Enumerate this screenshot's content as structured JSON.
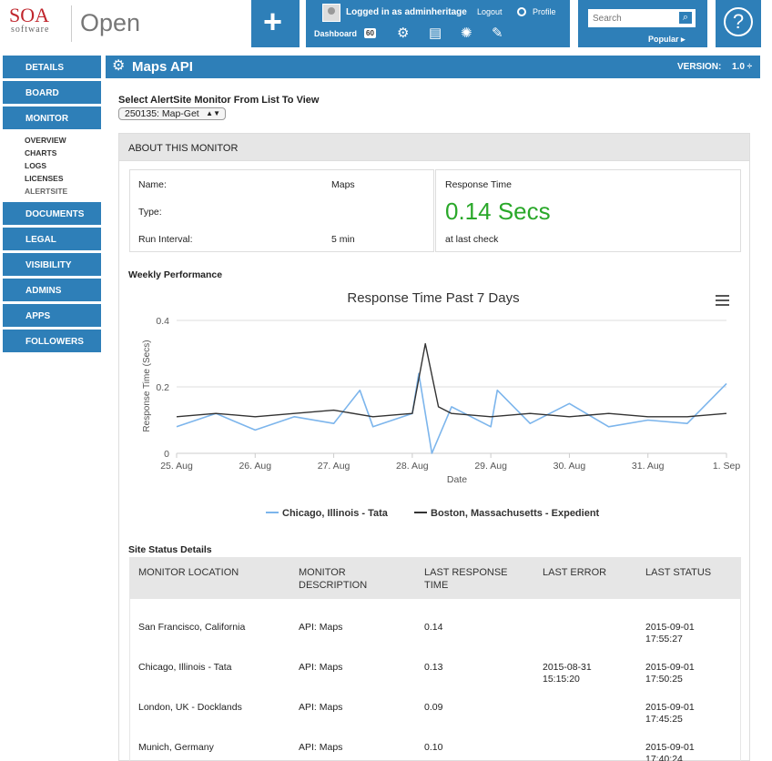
{
  "header": {
    "logo_soa": "SOA",
    "logo_software": "software",
    "logo_open": "Open",
    "user_text": "Logged in as adminheritage",
    "logout": "Logout",
    "profile": "Profile",
    "dashboard": "Dashboard",
    "dashboard_count": "60",
    "search_placeholder": "Search",
    "popular": "Popular ▸",
    "help": "?"
  },
  "sidebar": {
    "items": [
      "DETAILS",
      "BOARD",
      "MONITOR",
      "DOCUMENTS",
      "LEGAL",
      "VISIBILITY",
      "ADMINS",
      "APPS",
      "FOLLOWERS"
    ],
    "sub_items": [
      "OVERVIEW",
      "CHARTS",
      "LOGS",
      "LICENSES",
      "ALERTSITE"
    ]
  },
  "titlebar": {
    "title": "Maps API",
    "version_label": "VERSION:",
    "version_value": "1.0 ÷"
  },
  "monitor_select": {
    "label": "Select AlertSite Monitor From List To View",
    "value": "250135: Map-Get"
  },
  "about": {
    "heading": "ABOUT THIS MONITOR",
    "name_label": "Name:",
    "name_value": "Maps",
    "type_label": "Type:",
    "interval_label": "Run Interval:",
    "interval_value": "5 min",
    "response_label": "Response Time",
    "response_value": "0.14 Secs",
    "response_sub": "at last check"
  },
  "weekly_label": "Weekly Performance",
  "chart_data": {
    "type": "line",
    "title": "Response Time Past 7 Days",
    "xlabel": "Date",
    "ylabel": "Response Time (Secs)",
    "ylim": [
      0,
      0.4
    ],
    "yticks": [
      "0",
      "0.2",
      "0.4"
    ],
    "xticks": [
      "25. Aug",
      "26. Aug",
      "27. Aug",
      "28. Aug",
      "29. Aug",
      "30. Aug",
      "31. Aug",
      "1. Sep"
    ],
    "xlim": [
      "2015-08-25",
      "2015-09-01"
    ],
    "legend_placement": "bottom",
    "grid": true,
    "series": [
      {
        "name": "Chicago, Illinois - Tata",
        "color": "#7cb5ec",
        "x": [
          "2015-08-25",
          "2015-08-25 12:00",
          "2015-08-26",
          "2015-08-26 12:00",
          "2015-08-27",
          "2015-08-27 08:00",
          "2015-08-27 12:00",
          "2015-08-28",
          "2015-08-28 02:00",
          "2015-08-28 06:00",
          "2015-08-28 12:00",
          "2015-08-29",
          "2015-08-29 02:00",
          "2015-08-29 12:00",
          "2015-08-30",
          "2015-08-30 12:00",
          "2015-08-31",
          "2015-08-31 12:00",
          "2015-09-01"
        ],
        "values": [
          0.08,
          0.12,
          0.07,
          0.11,
          0.09,
          0.19,
          0.08,
          0.12,
          0.24,
          0.0,
          0.14,
          0.08,
          0.19,
          0.09,
          0.15,
          0.08,
          0.1,
          0.09,
          0.21
        ]
      },
      {
        "name": "Boston, Massachusetts - Expedient",
        "color": "#333333",
        "x": [
          "2015-08-25",
          "2015-08-25 12:00",
          "2015-08-26",
          "2015-08-26 12:00",
          "2015-08-27",
          "2015-08-27 12:00",
          "2015-08-28",
          "2015-08-28 04:00",
          "2015-08-28 08:00",
          "2015-08-28 12:00",
          "2015-08-29",
          "2015-08-29 12:00",
          "2015-08-30",
          "2015-08-30 12:00",
          "2015-08-31",
          "2015-08-31 12:00",
          "2015-09-01"
        ],
        "values": [
          0.11,
          0.12,
          0.11,
          0.12,
          0.13,
          0.11,
          0.12,
          0.33,
          0.14,
          0.12,
          0.11,
          0.12,
          0.11,
          0.12,
          0.11,
          0.11,
          0.12
        ]
      }
    ]
  },
  "site_status": {
    "heading": "Site Status Details",
    "columns": [
      "MONITOR LOCATION",
      "MONITOR\nDESCRIPTION",
      "LAST RESPONSE\nTIME",
      "LAST ERROR",
      "LAST STATUS"
    ],
    "rows": [
      [
        "San Francisco, California",
        "API: Maps",
        "0.14",
        "",
        "2015-09-01\n17:55:27"
      ],
      [
        "Chicago, Illinois - Tata",
        "API: Maps",
        "0.13",
        "2015-08-31\n15:15:20",
        "2015-09-01\n17:50:25"
      ],
      [
        "London, UK - Docklands",
        "API: Maps",
        "0.09",
        "",
        "2015-09-01\n17:45:25"
      ],
      [
        "Munich, Germany",
        "API: Maps",
        "0.10",
        "",
        "2015-09-01\n17:40:24"
      ]
    ]
  }
}
